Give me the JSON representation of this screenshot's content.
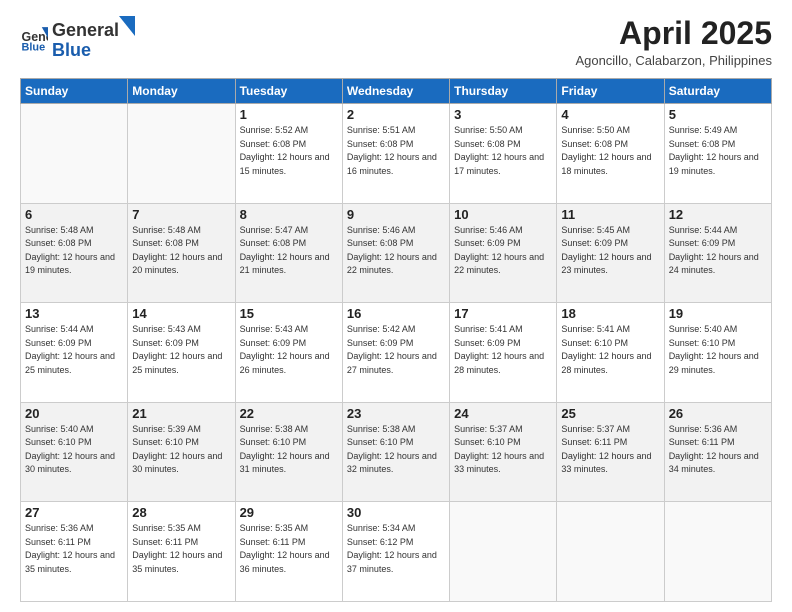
{
  "header": {
    "logo_general": "General",
    "logo_blue": "Blue",
    "month_title": "April 2025",
    "location": "Agoncillo, Calabarzon, Philippines"
  },
  "days_of_week": [
    "Sunday",
    "Monday",
    "Tuesday",
    "Wednesday",
    "Thursday",
    "Friday",
    "Saturday"
  ],
  "weeks": [
    [
      {
        "day": "",
        "info": ""
      },
      {
        "day": "",
        "info": ""
      },
      {
        "day": "1",
        "info": "Sunrise: 5:52 AM\nSunset: 6:08 PM\nDaylight: 12 hours and 15 minutes."
      },
      {
        "day": "2",
        "info": "Sunrise: 5:51 AM\nSunset: 6:08 PM\nDaylight: 12 hours and 16 minutes."
      },
      {
        "day": "3",
        "info": "Sunrise: 5:50 AM\nSunset: 6:08 PM\nDaylight: 12 hours and 17 minutes."
      },
      {
        "day": "4",
        "info": "Sunrise: 5:50 AM\nSunset: 6:08 PM\nDaylight: 12 hours and 18 minutes."
      },
      {
        "day": "5",
        "info": "Sunrise: 5:49 AM\nSunset: 6:08 PM\nDaylight: 12 hours and 19 minutes."
      }
    ],
    [
      {
        "day": "6",
        "info": "Sunrise: 5:48 AM\nSunset: 6:08 PM\nDaylight: 12 hours and 19 minutes."
      },
      {
        "day": "7",
        "info": "Sunrise: 5:48 AM\nSunset: 6:08 PM\nDaylight: 12 hours and 20 minutes."
      },
      {
        "day": "8",
        "info": "Sunrise: 5:47 AM\nSunset: 6:08 PM\nDaylight: 12 hours and 21 minutes."
      },
      {
        "day": "9",
        "info": "Sunrise: 5:46 AM\nSunset: 6:08 PM\nDaylight: 12 hours and 22 minutes."
      },
      {
        "day": "10",
        "info": "Sunrise: 5:46 AM\nSunset: 6:09 PM\nDaylight: 12 hours and 22 minutes."
      },
      {
        "day": "11",
        "info": "Sunrise: 5:45 AM\nSunset: 6:09 PM\nDaylight: 12 hours and 23 minutes."
      },
      {
        "day": "12",
        "info": "Sunrise: 5:44 AM\nSunset: 6:09 PM\nDaylight: 12 hours and 24 minutes."
      }
    ],
    [
      {
        "day": "13",
        "info": "Sunrise: 5:44 AM\nSunset: 6:09 PM\nDaylight: 12 hours and 25 minutes."
      },
      {
        "day": "14",
        "info": "Sunrise: 5:43 AM\nSunset: 6:09 PM\nDaylight: 12 hours and 25 minutes."
      },
      {
        "day": "15",
        "info": "Sunrise: 5:43 AM\nSunset: 6:09 PM\nDaylight: 12 hours and 26 minutes."
      },
      {
        "day": "16",
        "info": "Sunrise: 5:42 AM\nSunset: 6:09 PM\nDaylight: 12 hours and 27 minutes."
      },
      {
        "day": "17",
        "info": "Sunrise: 5:41 AM\nSunset: 6:09 PM\nDaylight: 12 hours and 28 minutes."
      },
      {
        "day": "18",
        "info": "Sunrise: 5:41 AM\nSunset: 6:10 PM\nDaylight: 12 hours and 28 minutes."
      },
      {
        "day": "19",
        "info": "Sunrise: 5:40 AM\nSunset: 6:10 PM\nDaylight: 12 hours and 29 minutes."
      }
    ],
    [
      {
        "day": "20",
        "info": "Sunrise: 5:40 AM\nSunset: 6:10 PM\nDaylight: 12 hours and 30 minutes."
      },
      {
        "day": "21",
        "info": "Sunrise: 5:39 AM\nSunset: 6:10 PM\nDaylight: 12 hours and 30 minutes."
      },
      {
        "day": "22",
        "info": "Sunrise: 5:38 AM\nSunset: 6:10 PM\nDaylight: 12 hours and 31 minutes."
      },
      {
        "day": "23",
        "info": "Sunrise: 5:38 AM\nSunset: 6:10 PM\nDaylight: 12 hours and 32 minutes."
      },
      {
        "day": "24",
        "info": "Sunrise: 5:37 AM\nSunset: 6:10 PM\nDaylight: 12 hours and 33 minutes."
      },
      {
        "day": "25",
        "info": "Sunrise: 5:37 AM\nSunset: 6:11 PM\nDaylight: 12 hours and 33 minutes."
      },
      {
        "day": "26",
        "info": "Sunrise: 5:36 AM\nSunset: 6:11 PM\nDaylight: 12 hours and 34 minutes."
      }
    ],
    [
      {
        "day": "27",
        "info": "Sunrise: 5:36 AM\nSunset: 6:11 PM\nDaylight: 12 hours and 35 minutes."
      },
      {
        "day": "28",
        "info": "Sunrise: 5:35 AM\nSunset: 6:11 PM\nDaylight: 12 hours and 35 minutes."
      },
      {
        "day": "29",
        "info": "Sunrise: 5:35 AM\nSunset: 6:11 PM\nDaylight: 12 hours and 36 minutes."
      },
      {
        "day": "30",
        "info": "Sunrise: 5:34 AM\nSunset: 6:12 PM\nDaylight: 12 hours and 37 minutes."
      },
      {
        "day": "",
        "info": ""
      },
      {
        "day": "",
        "info": ""
      },
      {
        "day": "",
        "info": ""
      }
    ]
  ]
}
